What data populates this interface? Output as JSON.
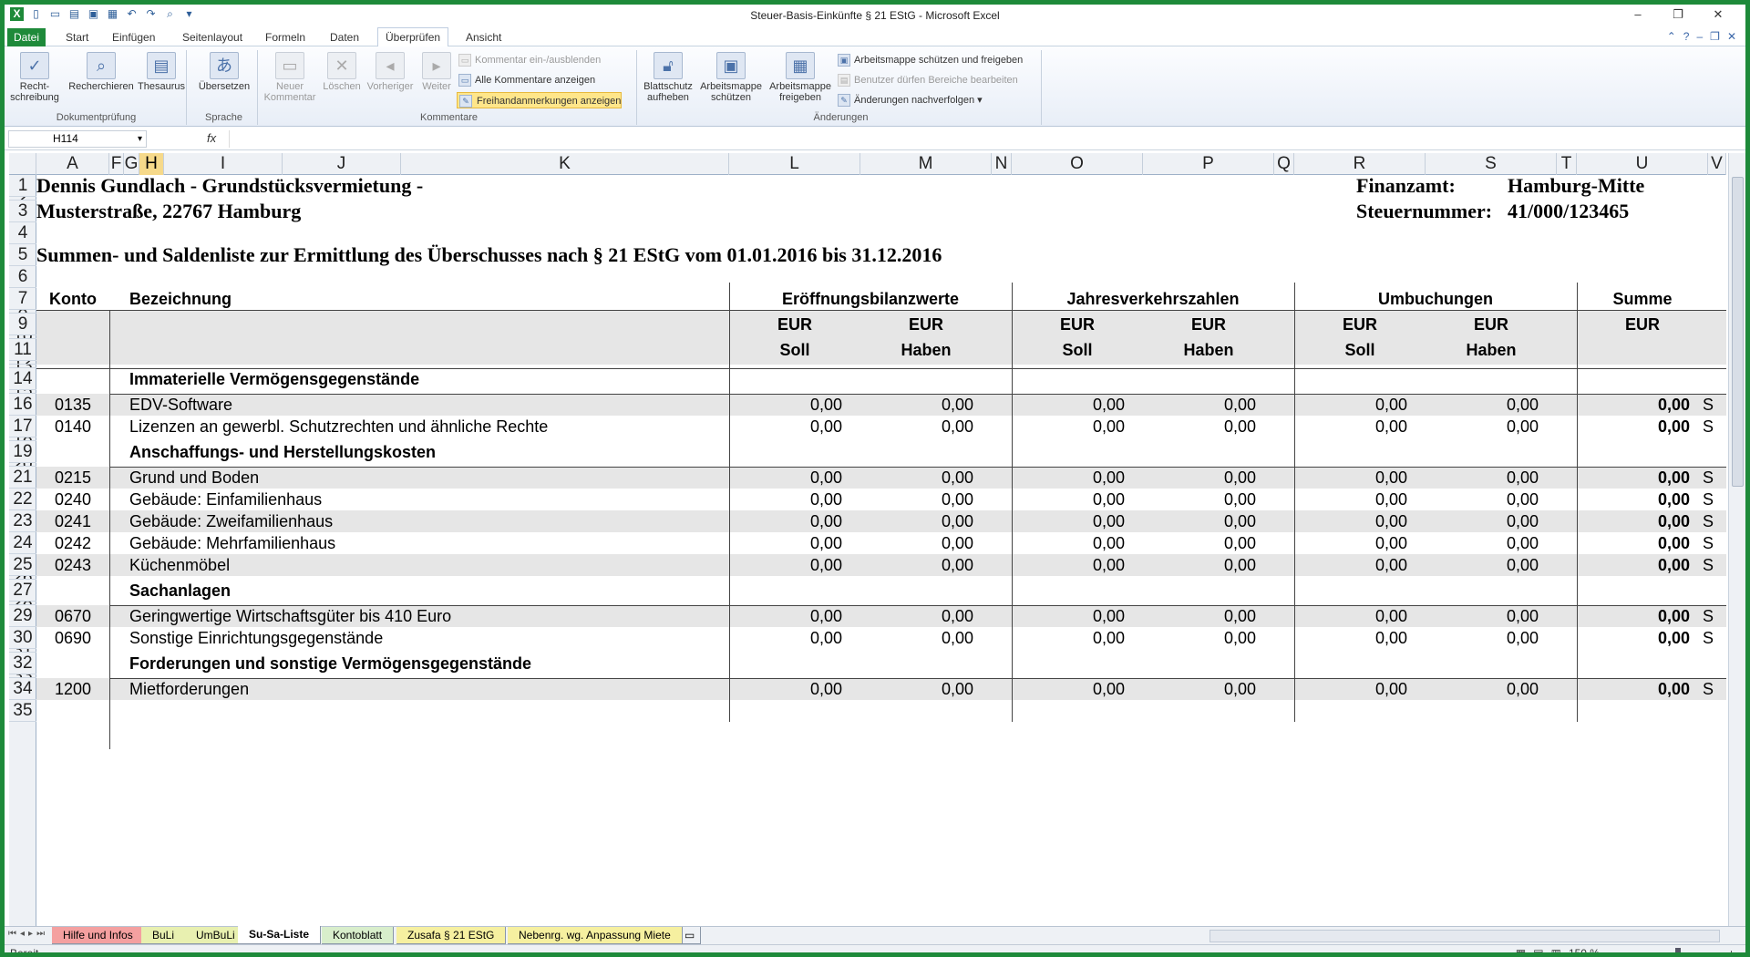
{
  "window": {
    "title": "Steuer-Basis-Einkünfte § 21 EStG  -  Microsoft Excel",
    "minimize": "–",
    "maximize": "❐",
    "close": "✕"
  },
  "ribbon_tabs": [
    "Datei",
    "Start",
    "Einfügen",
    "Seitenlayout",
    "Formeln",
    "Daten",
    "Überprüfen",
    "Ansicht"
  ],
  "ribbon_groups": {
    "doc": {
      "label": "Dokumentprüfung",
      "spell_line1": "Recht-",
      "spell_line2": "schreibung",
      "research": "Recherchieren",
      "thesaurus": "Thesaurus"
    },
    "lang": {
      "label": "Sprache",
      "translate": "Übersetzen"
    },
    "comments": {
      "label": "Kommentare",
      "new_line1": "Neuer",
      "new_line2": "Kommentar",
      "delete": "Löschen",
      "prev": "Vorheriger",
      "next": "Weiter",
      "toggle": "Kommentar ein-/ausblenden",
      "show_all": "Alle Kommentare anzeigen",
      "ink": "Freihandanmerkungen anzeigen"
    },
    "changes": {
      "label": "Änderungen",
      "unprotect_line1": "Blattschutz",
      "unprotect_line2": "aufheben",
      "protect_wb_line1": "Arbeitsmappe",
      "protect_wb_line2": "schützen",
      "share_line1": "Arbeitsmappe",
      "share_line2": "freigeben",
      "protect_share": "Arbeitsmappe schützen und freigeben",
      "allow_edit": "Benutzer dürfen Bereiche bearbeiten",
      "track": "Änderungen nachverfolgen"
    }
  },
  "formula_bar": {
    "name_box": "H114",
    "fx": "fx",
    "formula": ""
  },
  "columns": [
    "A",
    "F",
    "G",
    "H",
    "I",
    "J",
    "K",
    "L",
    "M",
    "N",
    "O",
    "P",
    "Q",
    "R",
    "S",
    "T",
    "U",
    "V"
  ],
  "rows": [
    "1",
    "2",
    "3",
    "4",
    "5",
    "6",
    "7",
    "8",
    "9",
    "10",
    "11",
    "12",
    "13",
    "14",
    "15",
    "16",
    "17",
    "18",
    "19",
    "20",
    "21",
    "22",
    "23",
    "24",
    "25",
    "26",
    "27",
    "28",
    "29",
    "30",
    "31",
    "32",
    "33",
    "34",
    "35"
  ],
  "sheet": {
    "owner": "Dennis Gundlach - Grundstücksvermietung -",
    "address": "Musterstraße, 22767 Hamburg",
    "finanzamt_label": "Finanzamt:",
    "finanzamt_value": "Hamburg-Mitte",
    "steuer_label": "Steuernummer:",
    "steuer_value": "41/000/123465",
    "title": "Summen- und Saldenliste zur Ermittlung des Überschusses nach § 21 EStG vom 01.01.2016 bis 31.12.2016",
    "headers": {
      "konto": "Konto",
      "bezeichnung": "Bezeichnung",
      "eroeffnung": "Eröffnungsbilanzwerte",
      "jahresverkehr": "Jahresverkehrszahlen",
      "umbuchungen": "Umbuchungen",
      "summe": "Summe",
      "eur": "EUR",
      "soll": "Soll",
      "haben": "Haben"
    },
    "sections": [
      {
        "title": "Immaterielle Vermögensgegenstände",
        "accounts": [
          {
            "konto": "0135",
            "name": "EDV-Software",
            "v1": "0,00",
            "v2": "0,00",
            "v3": "0,00",
            "v4": "0,00",
            "v5": "0,00",
            "v6": "0,00",
            "sum": "0,00",
            "sh": "S"
          },
          {
            "konto": "0140",
            "name": "Lizenzen an gewerbl. Schutzrechten und ähnliche Rechte",
            "v1": "0,00",
            "v2": "0,00",
            "v3": "0,00",
            "v4": "0,00",
            "v5": "0,00",
            "v6": "0,00",
            "sum": "0,00",
            "sh": "S"
          }
        ]
      },
      {
        "title": "Anschaffungs- und Herstellungskosten",
        "accounts": [
          {
            "konto": "0215",
            "name": "Grund und Boden",
            "v1": "0,00",
            "v2": "0,00",
            "v3": "0,00",
            "v4": "0,00",
            "v5": "0,00",
            "v6": "0,00",
            "sum": "0,00",
            "sh": "S"
          },
          {
            "konto": "0240",
            "name": "Gebäude: Einfamilienhaus",
            "v1": "0,00",
            "v2": "0,00",
            "v3": "0,00",
            "v4": "0,00",
            "v5": "0,00",
            "v6": "0,00",
            "sum": "0,00",
            "sh": "S"
          },
          {
            "konto": "0241",
            "name": "Gebäude: Zweifamilienhaus",
            "v1": "0,00",
            "v2": "0,00",
            "v3": "0,00",
            "v4": "0,00",
            "v5": "0,00",
            "v6": "0,00",
            "sum": "0,00",
            "sh": "S"
          },
          {
            "konto": "0242",
            "name": "Gebäude: Mehrfamilienhaus",
            "v1": "0,00",
            "v2": "0,00",
            "v3": "0,00",
            "v4": "0,00",
            "v5": "0,00",
            "v6": "0,00",
            "sum": "0,00",
            "sh": "S"
          },
          {
            "konto": "0243",
            "name": "Küchenmöbel",
            "v1": "0,00",
            "v2": "0,00",
            "v3": "0,00",
            "v4": "0,00",
            "v5": "0,00",
            "v6": "0,00",
            "sum": "0,00",
            "sh": "S"
          }
        ]
      },
      {
        "title": "Sachanlagen",
        "accounts": [
          {
            "konto": "0670",
            "name": "Geringwertige Wirtschaftsgüter bis 410 Euro",
            "v1": "0,00",
            "v2": "0,00",
            "v3": "0,00",
            "v4": "0,00",
            "v5": "0,00",
            "v6": "0,00",
            "sum": "0,00",
            "sh": "S"
          },
          {
            "konto": "0690",
            "name": "Sonstige Einrichtungsgegenstände",
            "v1": "0,00",
            "v2": "0,00",
            "v3": "0,00",
            "v4": "0,00",
            "v5": "0,00",
            "v6": "0,00",
            "sum": "0,00",
            "sh": "S"
          }
        ]
      },
      {
        "title": "Forderungen und sonstige Vermögensgegenstände",
        "accounts": [
          {
            "konto": "1200",
            "name": "Mietforderungen",
            "v1": "0,00",
            "v2": "0,00",
            "v3": "0,00",
            "v4": "0,00",
            "v5": "0,00",
            "v6": "0,00",
            "sum": "0,00",
            "sh": "S"
          }
        ]
      }
    ]
  },
  "sheet_tabs": [
    {
      "label": "Hilfe und Infos",
      "color": "#f4a0a0"
    },
    {
      "label": "BuLi",
      "color": "#e8f0b0"
    },
    {
      "label": "UmBuLi",
      "color": "#e8f0b0"
    },
    {
      "label": "Su-Sa-Liste",
      "color": "#ffffff"
    },
    {
      "label": "Kontoblatt",
      "color": "#d8eecb"
    },
    {
      "label": "Zusafa § 21 EStG",
      "color": "#f6f0a0"
    },
    {
      "label": "Nebenrg. wg. Anpassung Miete",
      "color": "#f6f0a0"
    }
  ],
  "status": {
    "ready": "Bereit",
    "zoom": "150 %"
  },
  "colors": {
    "excel_green": "#1e8a3a",
    "selected_header": "#f6d98a",
    "row_shade": "#e6e6e6"
  }
}
